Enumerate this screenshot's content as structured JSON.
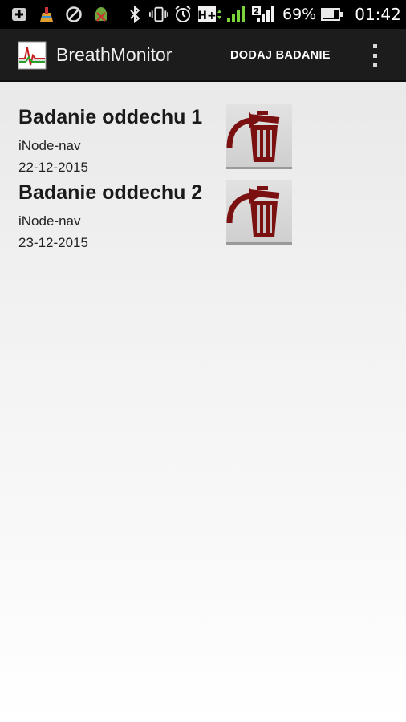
{
  "status_bar": {
    "battery_percent": "69%",
    "time": "01:42",
    "network_type": "H+",
    "sim_slot": "2",
    "icons": [
      "plus-badge-icon",
      "cleaner-icon",
      "do-not-disturb-icon",
      "android-debug-icon",
      "bluetooth-icon",
      "vibrate-icon",
      "alarm-icon",
      "network-type-icon",
      "signal-icon",
      "signal-sim2-icon",
      "battery-icon"
    ]
  },
  "action_bar": {
    "title": "BreathMonitor",
    "add_button_label": "DODAJ BADANIE",
    "icons": [
      "app-logo-icon",
      "overflow-menu-icon"
    ]
  },
  "colors": {
    "action_bar_bg": "#1c1c1c",
    "trash_red": "#7a1010",
    "status_bar_bg": "#000000"
  },
  "items": [
    {
      "title": "Badanie oddechu 1",
      "device": "iNode-nav",
      "date": "22-12-2015",
      "action_icon": "delete-trash-icon"
    },
    {
      "title": "Badanie oddechu 2",
      "device": "iNode-nav",
      "date": "23-12-2015",
      "action_icon": "delete-trash-icon"
    }
  ]
}
